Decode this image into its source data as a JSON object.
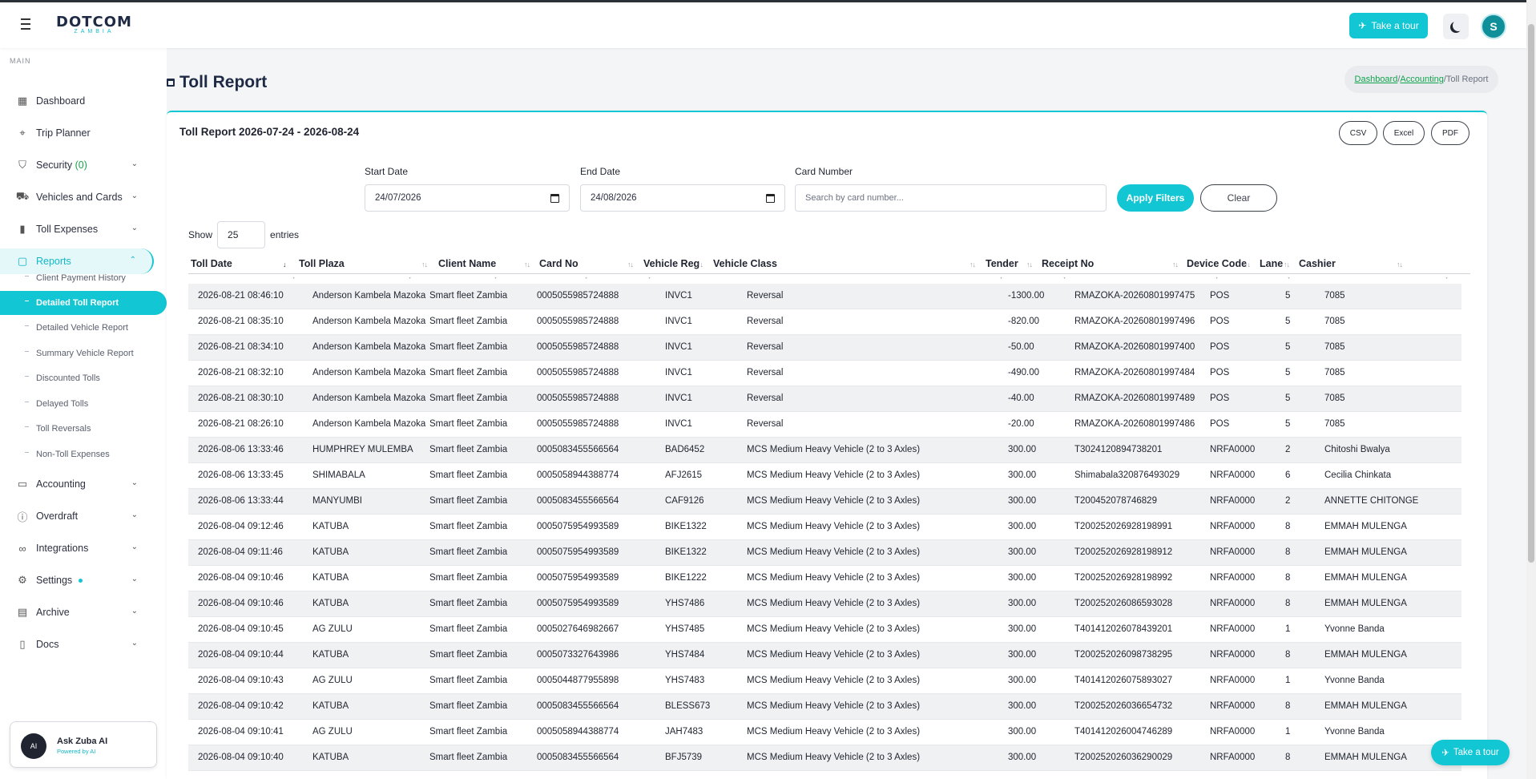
{
  "app": {
    "logo_main": "DOTCOM",
    "logo_sub": "ZAMBIA",
    "tour_label": "Take a tour",
    "user_initial": "S"
  },
  "sidebar": {
    "section": "MAIN",
    "items": [
      {
        "label": "Dashboard",
        "icon": "dashboard-icon"
      },
      {
        "label": "Trip Planner",
        "icon": "map-pin-icon"
      },
      {
        "label": "Security",
        "badge": "(0)",
        "icon": "shield-icon"
      },
      {
        "label": "Vehicles and Cards",
        "icon": "truck-icon"
      },
      {
        "label": "Toll Expenses",
        "icon": "bar-chart-icon"
      },
      {
        "label": "Reports",
        "icon": "clipboard-icon"
      },
      {
        "label": "Accounting",
        "icon": "book-icon"
      },
      {
        "label": "Overdraft",
        "icon": "alert-circle-icon"
      },
      {
        "label": "Integrations",
        "icon": "link-icon"
      },
      {
        "label": "Settings",
        "icon": "gear-icon"
      },
      {
        "label": "Archive",
        "icon": "archive-icon"
      },
      {
        "label": "Docs",
        "icon": "document-icon"
      }
    ],
    "report_sub": [
      "Client Payment History",
      "Detailed Toll Report",
      "Detailed Vehicle Report",
      "Summary Vehicle Report",
      "Discounted Tolls",
      "Delayed Tolls",
      "Toll Reversals",
      "Non-Toll Expenses"
    ],
    "assistant": {
      "title": "Ask Zuba AI",
      "subtitle": "Powered by AI",
      "icon_text": "AI"
    }
  },
  "page": {
    "title": "Toll Report",
    "breadcrumb": {
      "home": "Dashboard",
      "section": "Accounting",
      "current": "Toll Report"
    }
  },
  "report": {
    "title": "Toll Report 2026-07-24 - 2026-08-24",
    "exports": [
      "CSV",
      "Excel",
      "PDF"
    ],
    "filters": {
      "start_label": "Start Date",
      "start_value": "24/07/2026",
      "end_label": "End Date",
      "end_value": "24/08/2026",
      "card_label": "Card Number",
      "card_placeholder": "Search by card number...",
      "apply_label": "Apply Filters",
      "clear_label": "Clear"
    },
    "show_label": "Show",
    "show_value": "25",
    "entries_label": "entries",
    "columns": [
      "Toll Date",
      "Toll Plaza",
      "Client Name",
      "Card No",
      "Vehicle Reg",
      "Vehicle Class",
      "Tender",
      "Receipt No",
      "Device Code",
      "Lane",
      "Cashier"
    ],
    "rows": [
      [
        "2026-08-21 08:46:10",
        "Anderson Kambela Mazoka",
        "Smart fleet Zambia",
        "0005055985724888",
        "INVC1",
        "Reversal",
        "-1300.00",
        "RMAZOKA-20260801997475",
        "POS",
        "5",
        "7085"
      ],
      [
        "2026-08-21 08:35:10",
        "Anderson Kambela Mazoka",
        "Smart fleet Zambia",
        "0005055985724888",
        "INVC1",
        "Reversal",
        "-820.00",
        "RMAZOKA-20260801997496",
        "POS",
        "5",
        "7085"
      ],
      [
        "2026-08-21 08:34:10",
        "Anderson Kambela Mazoka",
        "Smart fleet Zambia",
        "0005055985724888",
        "INVC1",
        "Reversal",
        "-50.00",
        "RMAZOKA-20260801997400",
        "POS",
        "5",
        "7085"
      ],
      [
        "2026-08-21 08:32:10",
        "Anderson Kambela Mazoka",
        "Smart fleet Zambia",
        "0005055985724888",
        "INVC1",
        "Reversal",
        "-490.00",
        "RMAZOKA-20260801997484",
        "POS",
        "5",
        "7085"
      ],
      [
        "2026-08-21 08:30:10",
        "Anderson Kambela Mazoka",
        "Smart fleet Zambia",
        "0005055985724888",
        "INVC1",
        "Reversal",
        "-40.00",
        "RMAZOKA-20260801997489",
        "POS",
        "5",
        "7085"
      ],
      [
        "2026-08-21 08:26:10",
        "Anderson Kambela Mazoka",
        "Smart fleet Zambia",
        "0005055985724888",
        "INVC1",
        "Reversal",
        "-20.00",
        "RMAZOKA-20260801997486",
        "POS",
        "5",
        "7085"
      ],
      [
        "2026-08-06 13:33:46",
        "HUMPHREY MULEMBA",
        "Smart fleet Zambia",
        "0005083455566564",
        "BAD6452",
        "MCS Medium Heavy Vehicle (2 to 3 Axles)",
        "300.00",
        "T3024120894738201",
        "NRFA0000",
        "2",
        "Chitoshi Bwalya"
      ],
      [
        "2026-08-06 13:33:45",
        "SHIMABALA",
        "Smart fleet Zambia",
        "0005058944388774",
        "AFJ2615",
        "MCS Medium Heavy Vehicle (2 to 3 Axles)",
        "300.00",
        "Shimabala320876493029",
        "NRFA0000",
        "6",
        "Cecilia Chinkata"
      ],
      [
        "2026-08-06 13:33:44",
        "MANYUMBI",
        "Smart fleet Zambia",
        "0005083455566564",
        "CAF9126",
        "MCS Medium Heavy Vehicle (2 to 3 Axles)",
        "300.00",
        "T200452078746829",
        "NRFA0000",
        "2",
        "ANNETTE CHITONGE"
      ],
      [
        "2026-08-04 09:12:46",
        "KATUBA",
        "Smart fleet Zambia",
        "0005075954993589",
        "BIKE1322",
        "MCS Medium Heavy Vehicle (2 to 3 Axles)",
        "300.00",
        "T200252026928198991",
        "NRFA0000",
        "8",
        "EMMAH MULENGA"
      ],
      [
        "2026-08-04 09:11:46",
        "KATUBA",
        "Smart fleet Zambia",
        "0005075954993589",
        "BIKE1322",
        "MCS Medium Heavy Vehicle (2 to 3 Axles)",
        "300.00",
        "T200252026928198912",
        "NRFA0000",
        "8",
        "EMMAH MULENGA"
      ],
      [
        "2026-08-04 09:10:46",
        "KATUBA",
        "Smart fleet Zambia",
        "0005075954993589",
        "BIKE1222",
        "MCS Medium Heavy Vehicle (2 to 3 Axles)",
        "300.00",
        "T200252026928198992",
        "NRFA0000",
        "8",
        "EMMAH MULENGA"
      ],
      [
        "2026-08-04 09:10:46",
        "KATUBA",
        "Smart fleet Zambia",
        "0005075954993589",
        "YHS7486",
        "MCS Medium Heavy Vehicle (2 to 3 Axles)",
        "300.00",
        "T200252026086593028",
        "NRFA0000",
        "8",
        "EMMAH MULENGA"
      ],
      [
        "2026-08-04 09:10:45",
        "AG ZULU",
        "Smart fleet Zambia",
        "0005027646982667",
        "YHS7485",
        "MCS Medium Heavy Vehicle (2 to 3 Axles)",
        "300.00",
        "T401412026078439201",
        "NRFA0000",
        "1",
        "Yvonne Banda"
      ],
      [
        "2026-08-04 09:10:44",
        "KATUBA",
        "Smart fleet Zambia",
        "0005073327643986",
        "YHS7484",
        "MCS Medium Heavy Vehicle (2 to 3 Axles)",
        "300.00",
        "T200252026098738295",
        "NRFA0000",
        "8",
        "EMMAH MULENGA"
      ],
      [
        "2026-08-04 09:10:43",
        "AG ZULU",
        "Smart fleet Zambia",
        "0005044877955898",
        "YHS7483",
        "MCS Medium Heavy Vehicle (2 to 3 Axles)",
        "300.00",
        "T401412026075893027",
        "NRFA0000",
        "1",
        "Yvonne Banda"
      ],
      [
        "2026-08-04 09:10:42",
        "KATUBA",
        "Smart fleet Zambia",
        "0005083455566564",
        "BLESS673",
        "MCS Medium Heavy Vehicle (2 to 3 Axles)",
        "300.00",
        "T200252026036654732",
        "NRFA0000",
        "8",
        "EMMAH MULENGA"
      ],
      [
        "2026-08-04 09:10:41",
        "AG ZULU",
        "Smart fleet Zambia",
        "0005058944388774",
        "JAH7483",
        "MCS Medium Heavy Vehicle (2 to 3 Axles)",
        "300.00",
        "T401412026004746289",
        "NRFA0000",
        "1",
        "Yvonne Banda"
      ],
      [
        "2026-08-04 09:10:40",
        "KATUBA",
        "Smart fleet Zambia",
        "0005083455566564",
        "BFJ5739",
        "MCS Medium Heavy Vehicle (2 to 3 Axles)",
        "300.00",
        "T200252026036290029",
        "NRFA0000",
        "8",
        "EMMAH MULENGA"
      ]
    ]
  },
  "colors": {
    "accent": "#12c6d4",
    "link": "#12a34d"
  }
}
